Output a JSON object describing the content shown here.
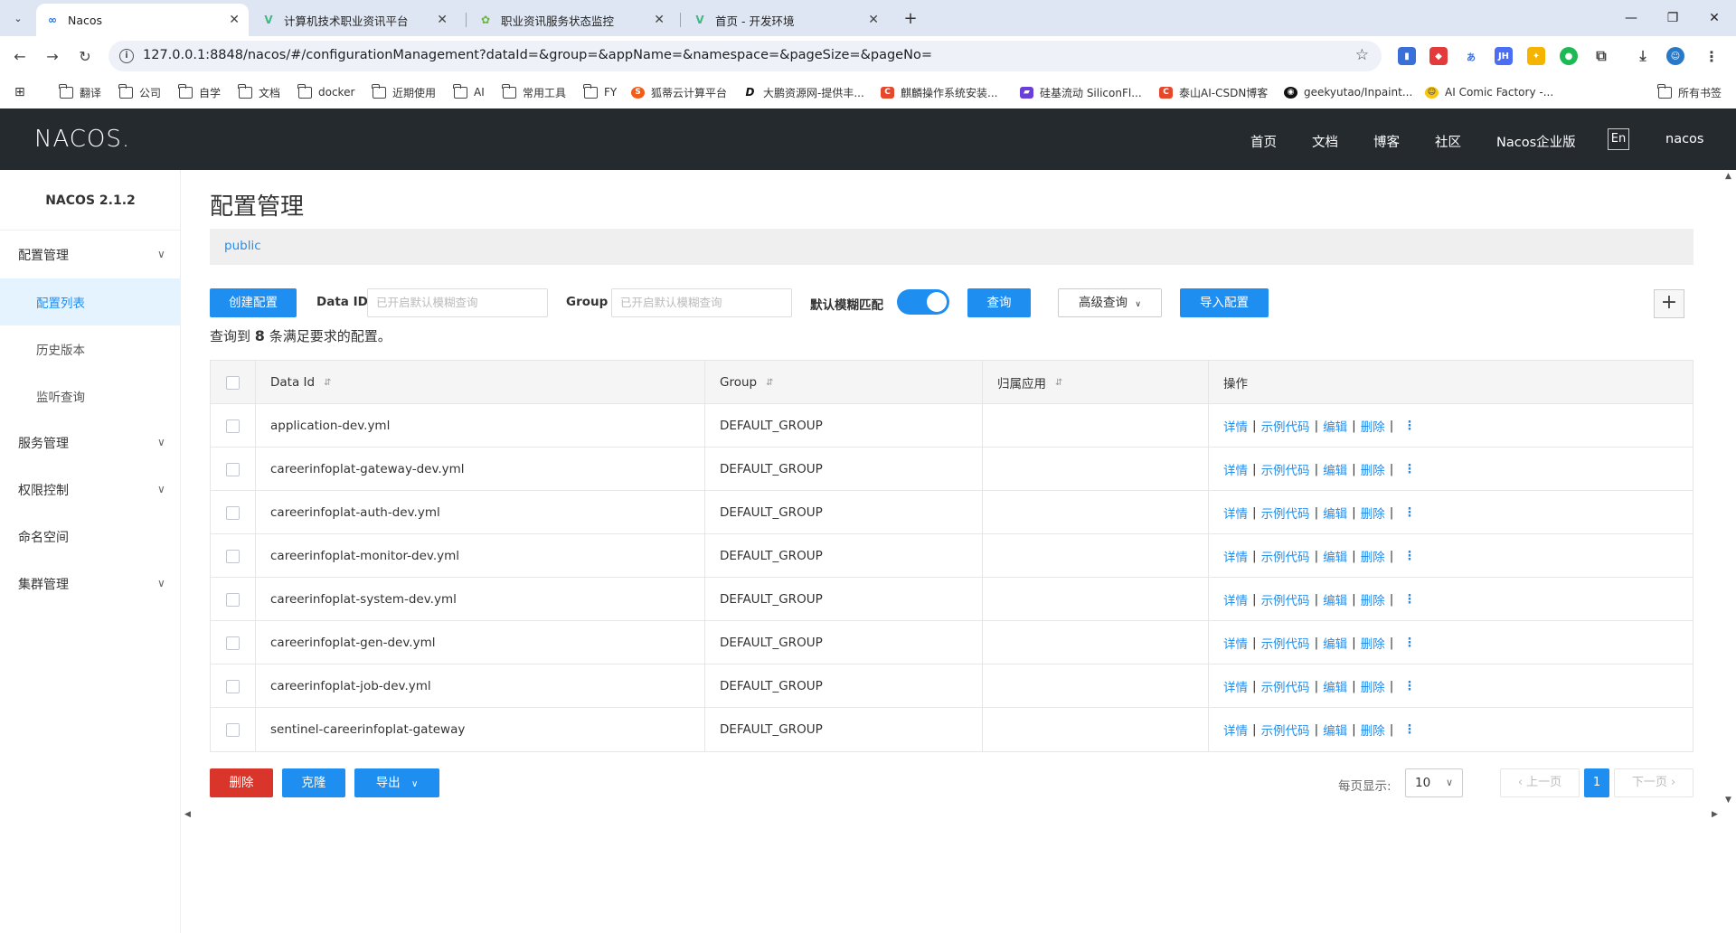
{
  "browser": {
    "tabs": [
      {
        "label": "Nacos",
        "active": true,
        "icon": "infinity-icon",
        "color": "#1a73e8"
      },
      {
        "label": "计算机技术职业资讯平台",
        "active": false,
        "icon": "vue-icon",
        "color": "#41b883"
      },
      {
        "label": "职业资讯服务状态监控",
        "active": false,
        "icon": "spring-icon",
        "color": "#6db33f"
      },
      {
        "label": "首页 - 开发环境",
        "active": false,
        "icon": "vue-icon",
        "color": "#41b883"
      }
    ],
    "new_tab": "+",
    "url": "127.0.0.1:8848/nacos/#/configurationManagement?dataId=&group=&appName=&namespace=&pageSize=&pageNo=",
    "bookmarks": [
      {
        "label": "翻译",
        "icon": "folder-icon"
      },
      {
        "label": "公司",
        "icon": "folder-icon"
      },
      {
        "label": "自学",
        "icon": "folder-icon"
      },
      {
        "label": "文档",
        "icon": "folder-icon"
      },
      {
        "label": "docker",
        "icon": "folder-icon"
      },
      {
        "label": "近期使用",
        "icon": "folder-icon"
      },
      {
        "label": "AI",
        "icon": "folder-icon"
      },
      {
        "label": "常用工具",
        "icon": "folder-icon"
      },
      {
        "label": "FY",
        "icon": "folder-icon"
      },
      {
        "label": "狐蒂云计算平台",
        "icon": "site-icon"
      },
      {
        "label": "大鹏资源网-提供丰...",
        "icon": "site-icon"
      },
      {
        "label": "麒麟操作系统安装...",
        "icon": "site-icon"
      },
      {
        "label": "硅基流动 SiliconFl...",
        "icon": "site-icon"
      },
      {
        "label": "泰山AI-CSDN博客",
        "icon": "site-icon"
      },
      {
        "label": "geekyutao/Inpaint...",
        "icon": "github-icon"
      },
      {
        "label": "AI Comic Factory -...",
        "icon": "site-icon"
      },
      {
        "label": "所有书签",
        "icon": "folder-icon"
      }
    ]
  },
  "header": {
    "logo": "NACOS.",
    "nav": [
      "首页",
      "文档",
      "博客",
      "社区",
      "Nacos企业版"
    ],
    "lang": "En",
    "user": "nacos"
  },
  "sidebar": {
    "version": "NACOS 2.1.2",
    "items": [
      {
        "label": "配置管理",
        "type": "group",
        "expanded": true
      },
      {
        "label": "配置列表",
        "type": "sub",
        "active": true
      },
      {
        "label": "历史版本",
        "type": "sub"
      },
      {
        "label": "监听查询",
        "type": "sub"
      },
      {
        "label": "服务管理",
        "type": "group"
      },
      {
        "label": "权限控制",
        "type": "group"
      },
      {
        "label": "命名空间",
        "type": "item"
      },
      {
        "label": "集群管理",
        "type": "group"
      }
    ]
  },
  "main": {
    "title": "配置管理",
    "namespace": "public",
    "create_button": "创建配置",
    "dataid_label": "Data ID",
    "dataid_placeholder": "已开启默认模糊查询",
    "group_label": "Group",
    "group_placeholder": "已开启默认模糊查询",
    "fuzzy_label": "默认模糊匹配",
    "fuzzy_on": true,
    "query_button": "查询",
    "advanced_button": "高级查询",
    "import_button": "导入配置",
    "result_prefix": "查询到",
    "result_count": "8",
    "result_suffix": "条满足要求的配置。"
  },
  "table": {
    "columns": [
      "Data Id",
      "Group",
      "归属应用",
      "操作"
    ],
    "actions": [
      "详情",
      "示例代码",
      "编辑",
      "删除"
    ],
    "rows": [
      {
        "data_id": "application-dev.yml",
        "group": "DEFAULT_GROUP",
        "app": ""
      },
      {
        "data_id": "careerinfoplat-gateway-dev.yml",
        "group": "DEFAULT_GROUP",
        "app": ""
      },
      {
        "data_id": "careerinfoplat-auth-dev.yml",
        "group": "DEFAULT_GROUP",
        "app": ""
      },
      {
        "data_id": "careerinfoplat-monitor-dev.yml",
        "group": "DEFAULT_GROUP",
        "app": ""
      },
      {
        "data_id": "careerinfoplat-system-dev.yml",
        "group": "DEFAULT_GROUP",
        "app": ""
      },
      {
        "data_id": "careerinfoplat-gen-dev.yml",
        "group": "DEFAULT_GROUP",
        "app": ""
      },
      {
        "data_id": "careerinfoplat-job-dev.yml",
        "group": "DEFAULT_GROUP",
        "app": ""
      },
      {
        "data_id": "sentinel-careerinfoplat-gateway",
        "group": "DEFAULT_GROUP",
        "app": ""
      }
    ]
  },
  "footer": {
    "delete_button": "删除",
    "clone_button": "克隆",
    "export_button": "导出",
    "page_size_label": "每页显示:",
    "page_size": "10",
    "prev": "上一页",
    "current_page": "1",
    "next": "下一页"
  },
  "colors": {
    "primary": "#1f8ef1",
    "danger": "#d9352a",
    "header_bg": "#252a2f"
  }
}
